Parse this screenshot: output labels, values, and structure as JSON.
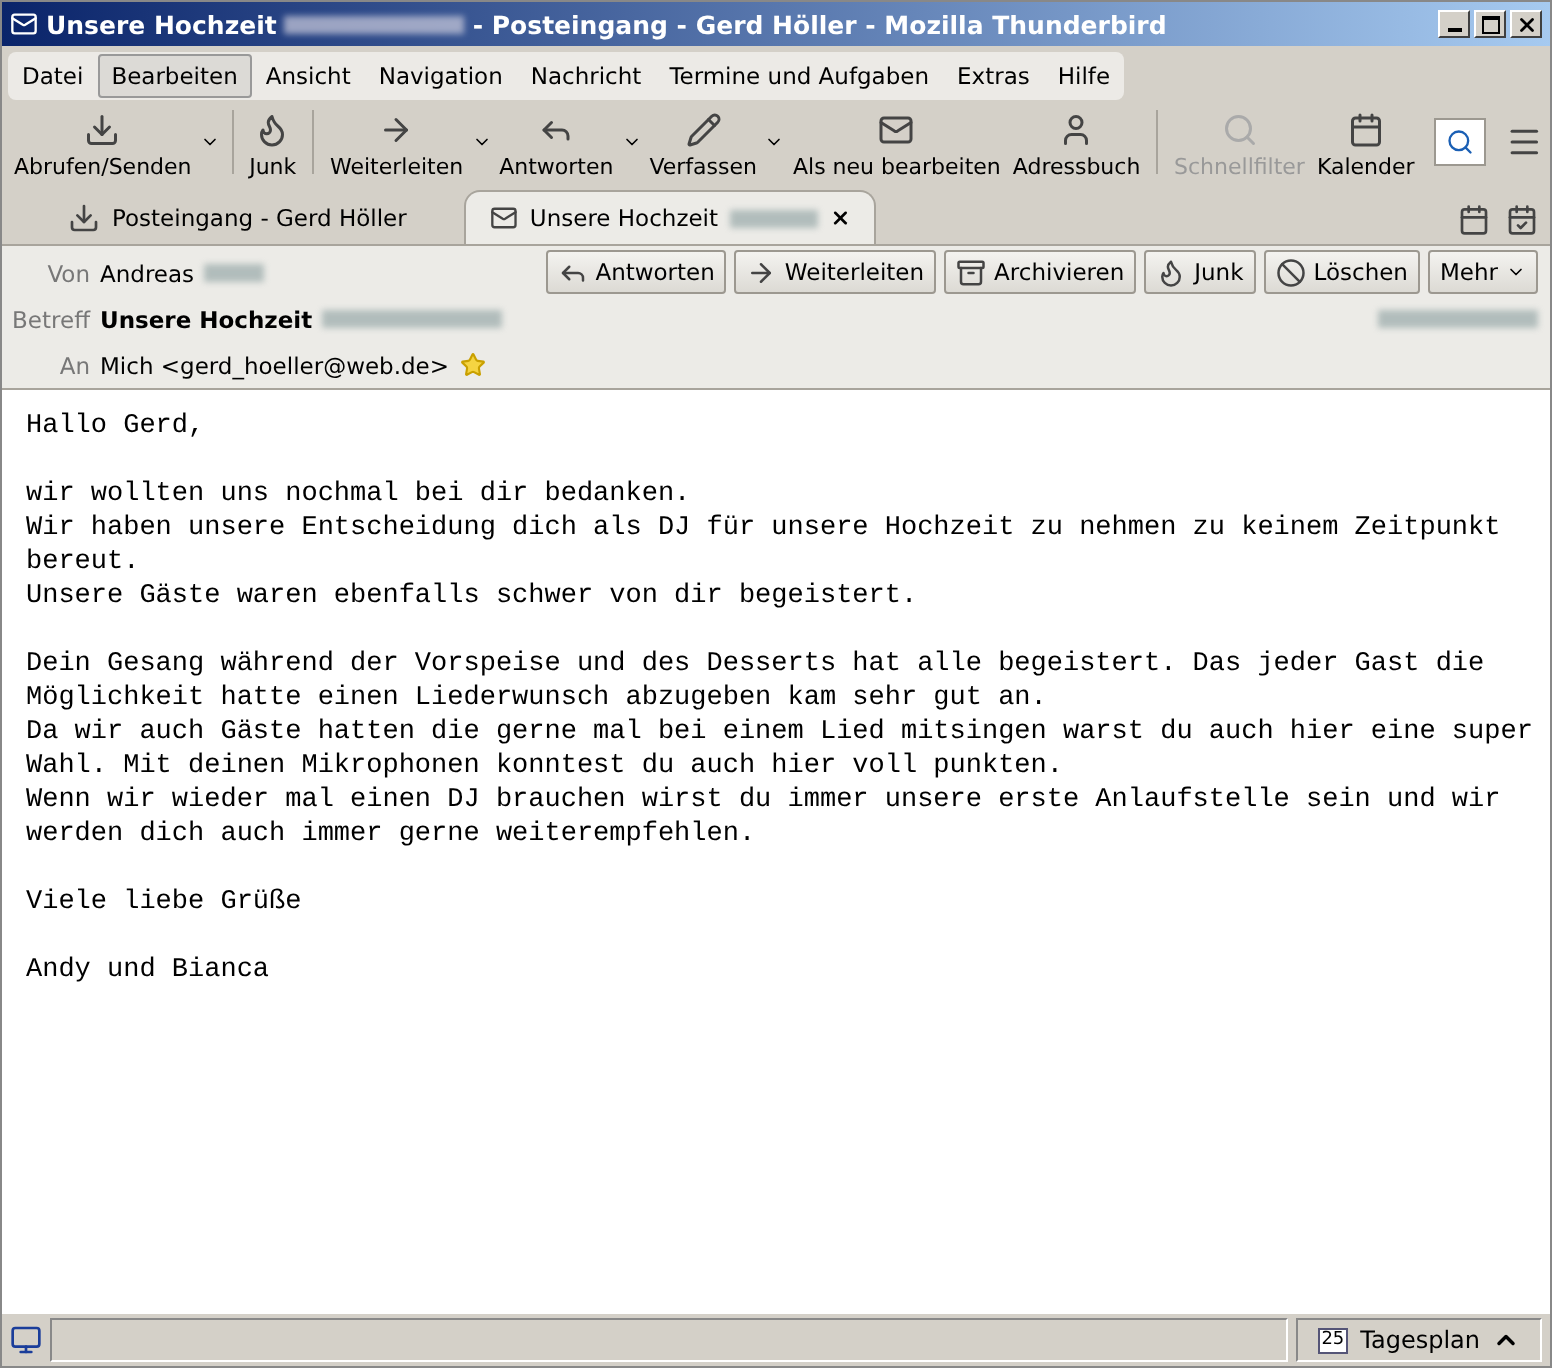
{
  "window": {
    "title": "Unsere Hochzeit",
    "title_rest": "- Posteingang - Gerd Höller - Mozilla Thunderbird"
  },
  "menu": [
    {
      "label": "Datei",
      "selected": false
    },
    {
      "label": "Bearbeiten",
      "selected": true
    },
    {
      "label": "Ansicht",
      "selected": false
    },
    {
      "label": "Navigation",
      "selected": false
    },
    {
      "label": "Nachricht",
      "selected": false
    },
    {
      "label": "Termine und Aufgaben",
      "selected": false
    },
    {
      "label": "Extras",
      "selected": false
    },
    {
      "label": "Hilfe",
      "selected": false
    }
  ],
  "toolbar": [
    {
      "kind": "download",
      "label": "Abrufen/Senden",
      "dropdown": true,
      "disabled": false
    },
    {
      "kind": "junk",
      "label": "Junk",
      "dropdown": false,
      "disabled": false
    },
    {
      "kind": "forward",
      "label": "Weiterleiten",
      "dropdown": true,
      "disabled": false
    },
    {
      "kind": "reply",
      "label": "Antworten",
      "dropdown": true,
      "disabled": false
    },
    {
      "kind": "compose",
      "label": "Verfassen",
      "dropdown": true,
      "disabled": false
    },
    {
      "kind": "editnew",
      "label": "Als neu bearbeiten",
      "dropdown": false,
      "disabled": false
    },
    {
      "kind": "addressbook",
      "label": "Adressbuch",
      "dropdown": false,
      "disabled": false
    },
    {
      "kind": "filter",
      "label": "Schnellfilter",
      "dropdown": false,
      "disabled": true
    },
    {
      "kind": "calendar",
      "label": "Kalender",
      "dropdown": false,
      "disabled": false
    }
  ],
  "tabs": [
    {
      "kind": "inbox",
      "label": "Posteingang - Gerd Höller",
      "selected": false
    },
    {
      "kind": "message",
      "label": "Unsere Hochzeit",
      "selected": true
    }
  ],
  "actions": [
    {
      "kind": "reply",
      "label": "Antworten"
    },
    {
      "kind": "forward",
      "label": "Weiterleiten"
    },
    {
      "kind": "archive",
      "label": "Archivieren"
    },
    {
      "kind": "junk",
      "label": "Junk"
    },
    {
      "kind": "delete",
      "label": "Löschen"
    },
    {
      "kind": "more",
      "label": "Mehr"
    }
  ],
  "header": {
    "from": {
      "label": "Von",
      "value": "Andreas"
    },
    "subject": {
      "label": "Betreff",
      "value": "Unsere Hochzeit"
    },
    "to": {
      "label": "An",
      "value": "Mich <gerd_hoeller@web.de>",
      "starred": true
    }
  },
  "body": [
    [
      "Hallo Gerd,"
    ],
    [
      "wir wollten uns nochmal bei dir bedanken.",
      "Wir haben unsere Entscheidung dich als DJ für unsere Hochzeit zu nehmen zu keinem Zeitpunkt",
      "bereut.",
      "Unsere Gäste waren ebenfalls schwer von dir begeistert."
    ],
    [
      "Dein Gesang während der Vorspeise und des Desserts hat alle begeistert. Das jeder Gast die",
      "Möglichkeit hatte einen Liederwunsch abzugeben kam sehr gut an.",
      "Da wir auch Gäste hatten die gerne mal bei einem Lied mitsingen warst du auch hier eine super",
      "Wahl. Mit deinen Mikrophonen konntest du auch hier voll punkten.",
      "Wenn wir wieder mal einen DJ brauchen wirst du immer unsere erste Anlaufstelle sein und wir",
      "werden dich auch immer gerne weiterempfehlen."
    ],
    [
      "Viele liebe Grüße"
    ],
    [
      "Andy und Bianca"
    ]
  ],
  "status_bar": {
    "calendar_day": "25",
    "today_pane": "Tagesplan"
  }
}
